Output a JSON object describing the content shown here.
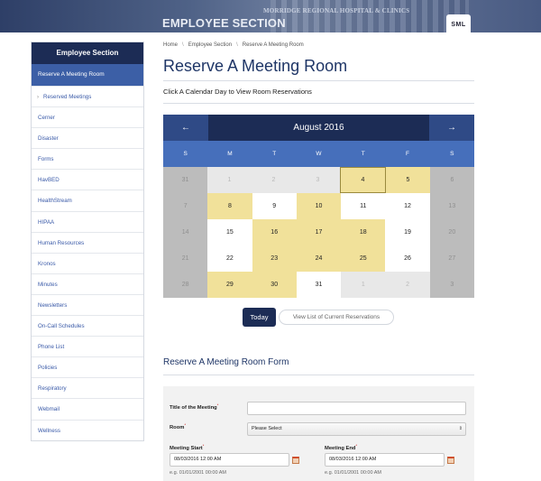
{
  "header": {
    "title": "EMPLOYEE SECTION",
    "sign": "MORRIDGE REGIONAL HOSPITAL & CLINICS",
    "size_toggle": "SML"
  },
  "sidebar": {
    "heading": "Employee Section",
    "active": "Reserve A Meeting Room",
    "items": [
      "Reserved Meetings",
      "Cerner",
      "Disaster",
      "Forms",
      "HavBED",
      "HealthStream",
      "HIPAA",
      "Human Resources",
      "Kronos",
      "Minutes",
      "Newsletters",
      "On-Call Schedules",
      "Phone List",
      "Policies",
      "Respiratory",
      "Webmail",
      "Wellness"
    ]
  },
  "breadcrumb": {
    "home": "Home",
    "section": "Employee Section",
    "current": "Reserve A Meeting Room",
    "separator": "\\"
  },
  "page": {
    "title": "Reserve A Meeting Room",
    "subtitle": "Click A Calendar Day to View Room Reservations"
  },
  "calendar": {
    "prev": "←",
    "next": "→",
    "month": "August 2016",
    "days_of_week": [
      "S",
      "M",
      "T",
      "W",
      "T",
      "F",
      "S"
    ],
    "weeks": [
      [
        {
          "d": "31",
          "s": "weekend"
        },
        {
          "d": "1",
          "s": "other"
        },
        {
          "d": "2",
          "s": "other"
        },
        {
          "d": "3",
          "s": "other"
        },
        {
          "d": "4",
          "s": "reserved today"
        },
        {
          "d": "5",
          "s": "reserved"
        },
        {
          "d": "6",
          "s": "weekend"
        }
      ],
      [
        {
          "d": "7",
          "s": "weekend"
        },
        {
          "d": "8",
          "s": "reserved"
        },
        {
          "d": "9",
          "s": ""
        },
        {
          "d": "10",
          "s": "reserved"
        },
        {
          "d": "11",
          "s": ""
        },
        {
          "d": "12",
          "s": ""
        },
        {
          "d": "13",
          "s": "weekend"
        }
      ],
      [
        {
          "d": "14",
          "s": "weekend"
        },
        {
          "d": "15",
          "s": ""
        },
        {
          "d": "16",
          "s": "reserved"
        },
        {
          "d": "17",
          "s": "reserved"
        },
        {
          "d": "18",
          "s": "reserved"
        },
        {
          "d": "19",
          "s": ""
        },
        {
          "d": "20",
          "s": "weekend"
        }
      ],
      [
        {
          "d": "21",
          "s": "weekend"
        },
        {
          "d": "22",
          "s": ""
        },
        {
          "d": "23",
          "s": "reserved"
        },
        {
          "d": "24",
          "s": "reserved"
        },
        {
          "d": "25",
          "s": "reserved"
        },
        {
          "d": "26",
          "s": ""
        },
        {
          "d": "27",
          "s": "weekend"
        }
      ],
      [
        {
          "d": "28",
          "s": "weekend"
        },
        {
          "d": "29",
          "s": "reserved"
        },
        {
          "d": "30",
          "s": "reserved"
        },
        {
          "d": "31",
          "s": ""
        },
        {
          "d": "1",
          "s": "other"
        },
        {
          "d": "2",
          "s": "other"
        },
        {
          "d": "3",
          "s": "weekend"
        }
      ]
    ],
    "today_button": "Today",
    "list_button": "View List of Current Reservations"
  },
  "form": {
    "title": "Reserve A Meeting Room Form",
    "meeting_title_label": "Title of the Meeting",
    "meeting_title_value": "",
    "room_label": "Room",
    "room_value": "Please Select",
    "start_label": "Meeting Start",
    "start_value": "08/03/2016 12:00 AM",
    "start_hint": "e.g. 01/01/2001 00:00 AM",
    "end_label": "Meeting End",
    "end_value": "08/03/2016 12:00 AM",
    "end_hint": "e.g. 01/01/2001 00:00 AM",
    "required_mark": "*"
  },
  "colors": {
    "navy": "#1c2c55",
    "blue": "#466fbb",
    "reserved": "#f1e19a",
    "weekend": "#bcbcbc"
  }
}
